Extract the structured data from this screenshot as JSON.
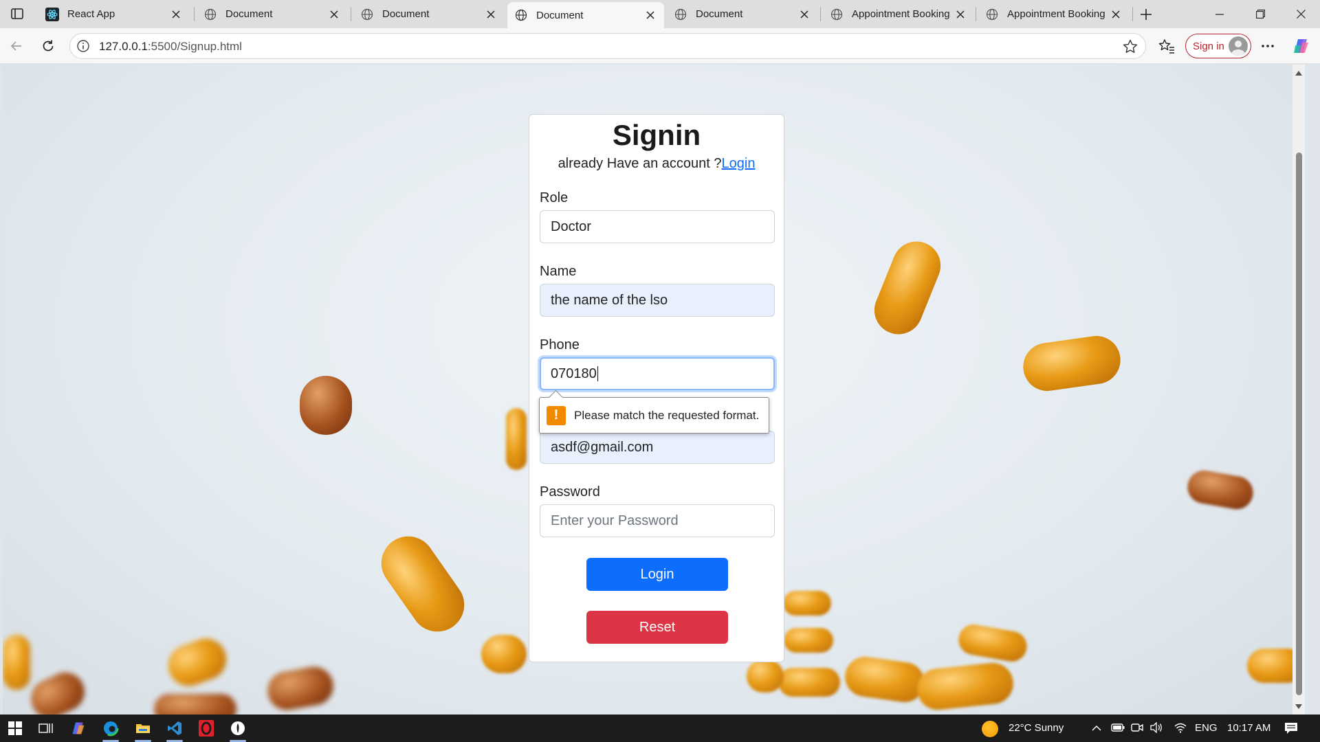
{
  "browser": {
    "tabs": [
      {
        "title": "React App",
        "icon": "react-icon",
        "active": false
      },
      {
        "title": "Document",
        "icon": "globe-icon",
        "active": false
      },
      {
        "title": "Document",
        "icon": "globe-icon",
        "active": false
      },
      {
        "title": "Document",
        "icon": "globe-icon",
        "active": true
      },
      {
        "title": "Document",
        "icon": "globe-icon",
        "active": false
      },
      {
        "title": "Appointment Booking",
        "icon": "globe-icon",
        "active": false
      },
      {
        "title": "Appointment Booking",
        "icon": "globe-icon",
        "active": false
      }
    ],
    "url_host": "127.0.0.1",
    "url_path": ":5500/Signup.html",
    "signin_label": "Sign in"
  },
  "page": {
    "heading": "Signin",
    "subtitle_text": "already Have an account ?",
    "subtitle_link": "Login",
    "fields": {
      "role_label": "Role",
      "role_value": "Doctor",
      "name_label": "Name",
      "name_value": "the name of the lso",
      "phone_label": "Phone",
      "phone_value": "070180",
      "email_value": "asdf@gmail.com",
      "password_label": "Password",
      "password_placeholder": "Enter your Password"
    },
    "validation_message": "Please match the requested format.",
    "login_button": "Login",
    "reset_button": "Reset"
  },
  "taskbar": {
    "weather": "22°C  Sunny",
    "language": "ENG",
    "time": "10:17 AM"
  },
  "colors": {
    "primary": "#0d6efd",
    "danger": "#dc3545",
    "signin_accent": "#b5212b",
    "warning": "#f28a00"
  }
}
